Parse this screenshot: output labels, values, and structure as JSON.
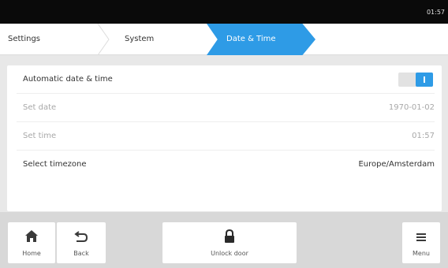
{
  "status_bar": {
    "time": "01:57"
  },
  "breadcrumbs": {
    "items": [
      {
        "label": "Settings"
      },
      {
        "label": "System"
      },
      {
        "label": "Date & Time"
      }
    ],
    "active_color": "#2e9be6"
  },
  "settings": {
    "automatic": {
      "label": "Automatic date & time",
      "enabled": true
    },
    "date": {
      "label": "Set date",
      "value": "1970-01-02"
    },
    "time": {
      "label": "Set time",
      "value": "01:57"
    },
    "timezone": {
      "label": "Select timezone",
      "value": "Europe/Amsterdam"
    }
  },
  "bottom_bar": {
    "home": {
      "label": "Home",
      "icon": "home-icon"
    },
    "back": {
      "label": "Back",
      "icon": "back-arrow-icon"
    },
    "unlock": {
      "label": "Unlock door",
      "icon": "lock-icon"
    },
    "menu": {
      "label": "Menu",
      "icon": "hamburger-menu-icon"
    }
  }
}
